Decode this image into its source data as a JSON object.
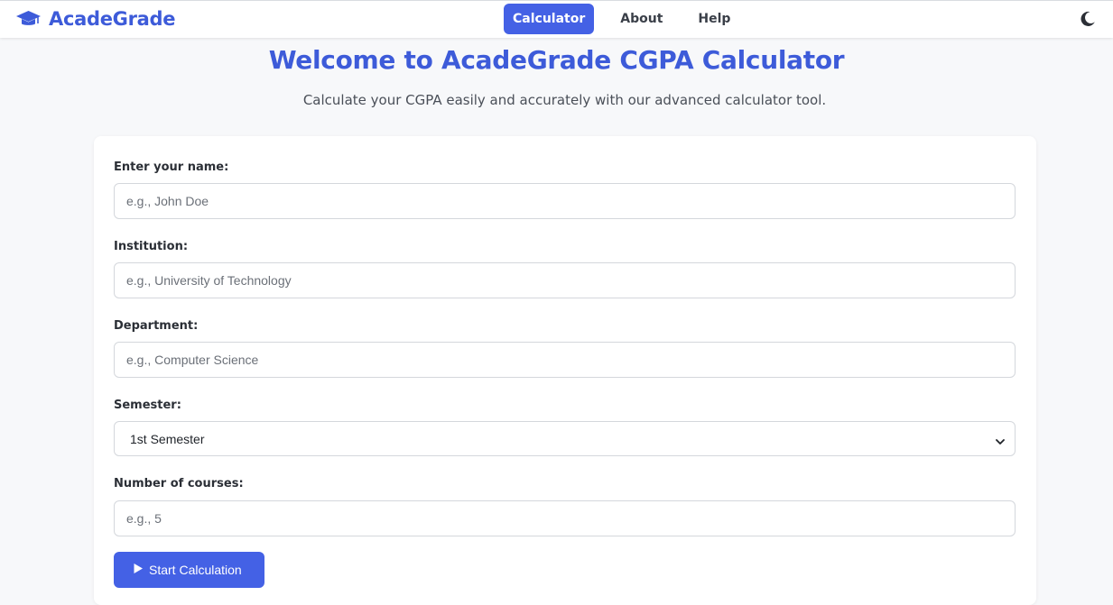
{
  "nav": {
    "brand": "AcadeGrade",
    "brand_icon": "graduation-cap-icon",
    "links": [
      "Calculator",
      "About",
      "Help"
    ],
    "active": "Calculator",
    "theme_icon": "moon-icon"
  },
  "hero": {
    "title": "Welcome to AcadeGrade CGPA Calculator",
    "subtitle": "Calculate your CGPA easily and accurately with our advanced calculator tool."
  },
  "form": {
    "name": {
      "label": "Enter your name:",
      "placeholder": "e.g., John Doe",
      "value": ""
    },
    "institution": {
      "label": "Institution:",
      "placeholder": "e.g., University of Technology",
      "value": ""
    },
    "department": {
      "label": "Department:",
      "placeholder": "e.g., Computer Science",
      "value": ""
    },
    "semester": {
      "label": "Semester:",
      "selected": "1st Semester"
    },
    "courses": {
      "label": "Number of courses:",
      "placeholder": "e.g., 5",
      "value": ""
    },
    "submit_label": "Start Calculation",
    "submit_icon": "play-icon"
  },
  "colors": {
    "accent": "#4461e5",
    "brand_text": "#3d5bd9",
    "background": "#f7f8fa"
  }
}
